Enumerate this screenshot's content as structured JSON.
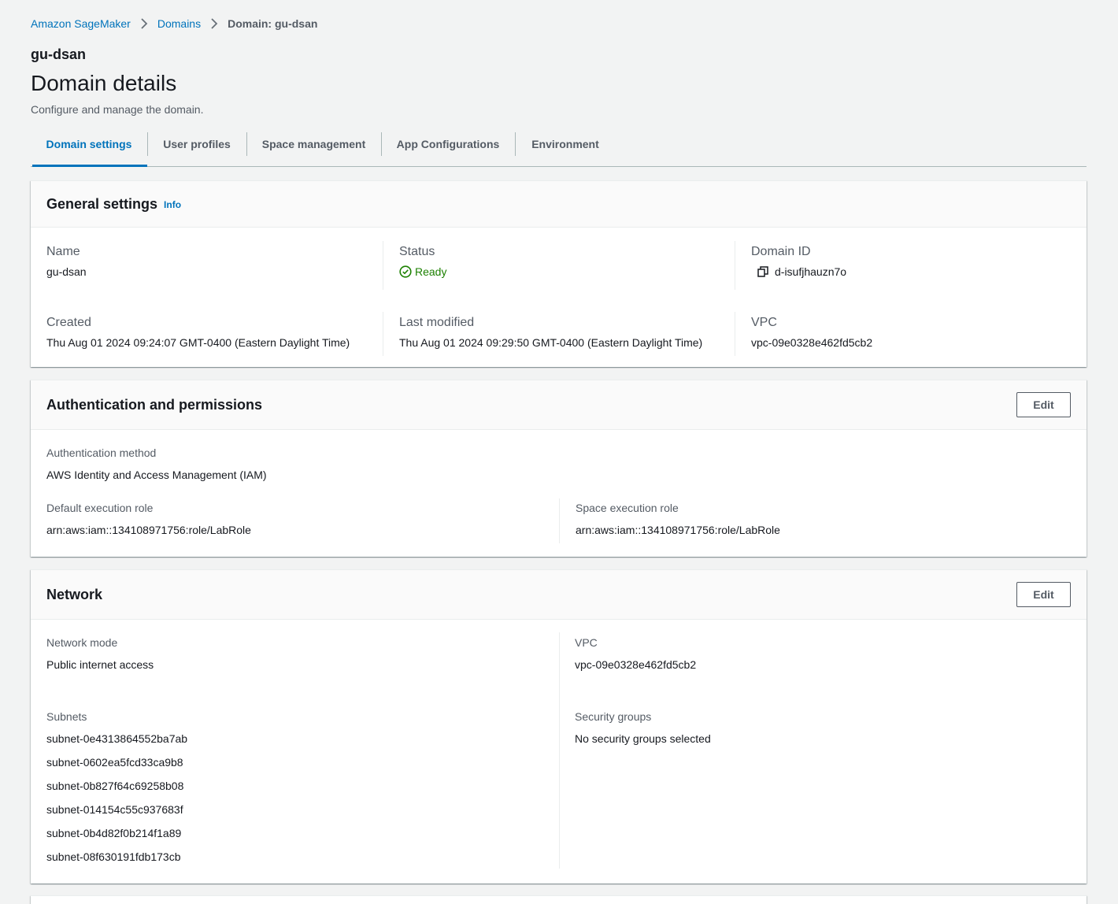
{
  "breadcrumb": {
    "items": [
      "Amazon SageMaker",
      "Domains"
    ],
    "current": "Domain: gu-dsan"
  },
  "header": {
    "name": "gu-dsan",
    "title": "Domain details",
    "description": "Configure and manage the domain."
  },
  "tabs": [
    {
      "label": "Domain settings",
      "active": true
    },
    {
      "label": "User profiles",
      "active": false
    },
    {
      "label": "Space management",
      "active": false
    },
    {
      "label": "App Configurations",
      "active": false
    },
    {
      "label": "Environment",
      "active": false
    }
  ],
  "general": {
    "title": "General settings",
    "info": "Info",
    "name_label": "Name",
    "name_value": "gu-dsan",
    "status_label": "Status",
    "status_value": "Ready",
    "domain_id_label": "Domain ID",
    "domain_id_value": "d-isufjhauzn7o",
    "created_label": "Created",
    "created_value": "Thu Aug 01 2024 09:24:07 GMT-0400 (Eastern Daylight Time)",
    "modified_label": "Last modified",
    "modified_value": "Thu Aug 01 2024 09:29:50 GMT-0400 (Eastern Daylight Time)",
    "vpc_label": "VPC",
    "vpc_value": "vpc-09e0328e462fd5cb2"
  },
  "auth": {
    "title": "Authentication and permissions",
    "edit": "Edit",
    "method_label": "Authentication method",
    "method_value": "AWS Identity and Access Management (IAM)",
    "default_role_label": "Default execution role",
    "default_role_value": "arn:aws:iam::134108971756:role/LabRole",
    "space_role_label": "Space execution role",
    "space_role_value": "arn:aws:iam::134108971756:role/LabRole"
  },
  "network": {
    "title": "Network",
    "edit": "Edit",
    "mode_label": "Network mode",
    "mode_value": "Public internet access",
    "vpc_label": "VPC",
    "vpc_value": "vpc-09e0328e462fd5cb2",
    "subnets_label": "Subnets",
    "subnets": [
      "subnet-0e4313864552ba7ab",
      "subnet-0602ea5fcd33ca9b8",
      "subnet-0b827f64c69258b08",
      "subnet-014154c55c937683f",
      "subnet-0b4d82f0b214f1a89",
      "subnet-08f630191fdb173cb"
    ],
    "sg_label": "Security groups",
    "sg_value": "No security groups selected"
  },
  "colors": {
    "link": "#0073bb",
    "success": "#1d8102",
    "background": "#f2f3f3"
  }
}
